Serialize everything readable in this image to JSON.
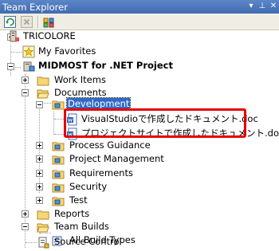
{
  "window": {
    "title": "Team Explorer",
    "pin_glyph": "▾",
    "pushpin_glyph": "⊥",
    "close_glyph": "✕"
  },
  "toolbar": {
    "buttons": [
      "refresh",
      "stop",
      "add-team-project"
    ]
  },
  "tree": {
    "server": "TRICOLORE",
    "favorites": "My Favorites",
    "project": "MIDMOST for .NET Project",
    "work_items": "Work Items",
    "documents": "Documents",
    "development": "Development",
    "doc1": "VisualStudioで作成したドキュメント.doc",
    "doc2": "プロジェクトサイトで作成したドキュメント.doc",
    "process_guidance": "Process Guidance",
    "project_management": "Project Management",
    "requirements": "Requirements",
    "security": "Security",
    "test": "Test",
    "reports": "Reports",
    "team_builds": "Team Builds",
    "all_build_types": "All Build Types",
    "source_control": "Source Control"
  },
  "colors": {
    "highlight_border": "#e60000",
    "selection": "#316ac5"
  }
}
